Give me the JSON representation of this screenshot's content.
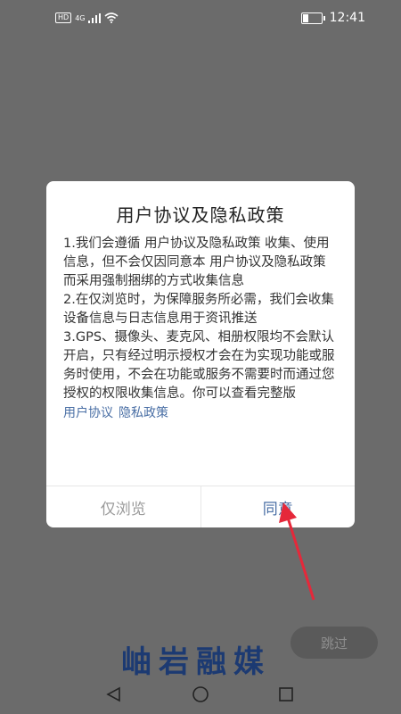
{
  "status_bar": {
    "network": "4G",
    "hd_label": "HD",
    "time": "12:41",
    "battery_level": 0.3
  },
  "dialog": {
    "title": "用户协议及隐私政策",
    "paragraphs": [
      "1.我们会遵循 用户协议及隐私政策 收集、使用信息，但不会仅因同意本 用户协议及隐私政策 而采用强制捆绑的方式收集信息",
      "2.在仅浏览时，为保障服务所必需，我们会收集设备信息与日志信息用于资讯推送",
      "3.GPS、摄像头、麦克风、相册权限均不会默认开启，只有经过明示授权才会在为实现功能或服务时使用，不会在功能或服务不需要时而通过您授权的权限收集信息。你可以查看完整版"
    ],
    "link_user_agreement": "用户协议",
    "link_privacy_policy": "隐私政策",
    "browse_only_label": "仅浏览",
    "agree_label": "同意"
  },
  "skip_label": "跳过",
  "logo_text": "岫岩融媒",
  "colors": {
    "overlay": "#6b6b6b",
    "link": "#4a6fa5",
    "arrow": "#e5283a",
    "logo": "#1c3a72"
  }
}
